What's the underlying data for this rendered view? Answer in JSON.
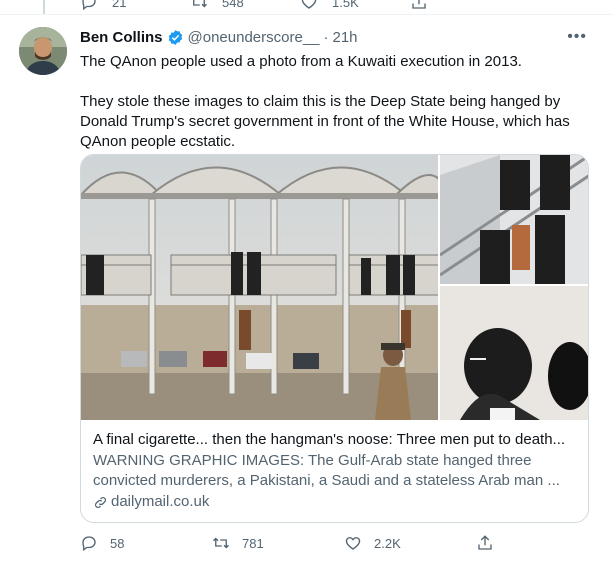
{
  "previous_tweet": {
    "reply_count": "21",
    "retweet_count": "548",
    "like_count": "1.5K"
  },
  "tweet": {
    "author_name": "Ben Collins",
    "handle": "@oneunderscore__",
    "separator": "·",
    "time": "21h",
    "more_label": "•••",
    "paragraphs": [
      "The QAnon people used a photo from a Kuwaiti execution in 2013.",
      "They stole these images to claim this is the Deep State being hanged by Donald Trump's secret government in front of the White House, which has QAnon people ecstatic."
    ],
    "card": {
      "title": "A final cigarette... then the hangman's noose: Three men put to death...",
      "description": "WARNING GRAPHIC IMAGES: The Gulf-Arab state hanged three convicted murderers, a Pakistani, a Saudi and a stateless Arab man ...",
      "domain": "dailymail.co.uk"
    },
    "actions": {
      "reply_count": "58",
      "retweet_count": "781",
      "like_count": "2.2K"
    }
  },
  "colors": {
    "text": "#0f1419",
    "secondary": "#536471",
    "verified": "#1d9bf0",
    "border": "#cfd9de"
  }
}
